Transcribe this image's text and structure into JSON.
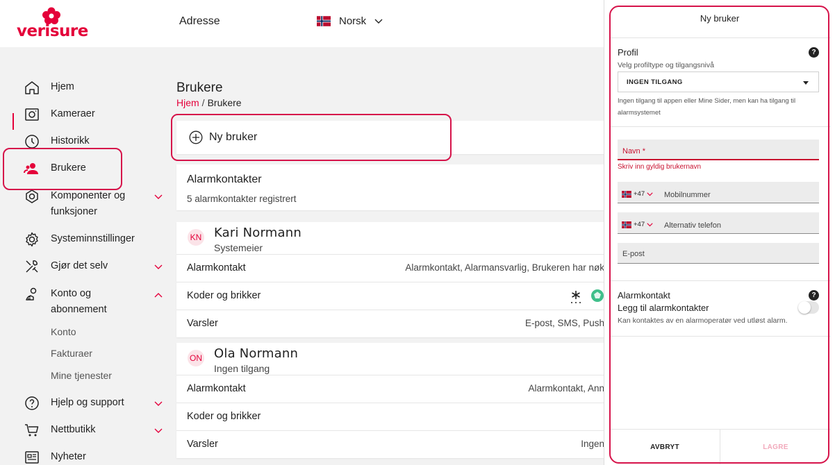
{
  "brand": {
    "name": "verisure",
    "color": "#e4003a"
  },
  "header": {
    "address_label": "Adresse",
    "language_label": "Norsk",
    "language_flag": "norway-flag-icon"
  },
  "sidebar": {
    "items": [
      {
        "label": "Hjem",
        "icon": "home-icon"
      },
      {
        "label": "Kameraer",
        "icon": "camera-icon"
      },
      {
        "label": "Historikk",
        "icon": "clock-icon"
      },
      {
        "label": "Brukere",
        "icon": "users-icon",
        "active": true
      },
      {
        "label_line1": "Komponenter og",
        "label_line2": "funksjoner",
        "icon": "components-icon"
      },
      {
        "label": "Systeminnstillinger",
        "icon": "gear-icon"
      },
      {
        "label": "Gjør det selv",
        "icon": "tools-icon"
      },
      {
        "label_line1": "Konto og",
        "label_line2": "abonnement",
        "icon": "account-icon"
      },
      {
        "label": "Hjelp og support",
        "icon": "help-icon"
      },
      {
        "label": "Nettbutikk",
        "icon": "cart-icon"
      },
      {
        "label": "Nyheter",
        "icon": "news-icon"
      }
    ],
    "sub_items": [
      "Konto",
      "Fakturaer",
      "Mine tjenester"
    ]
  },
  "main": {
    "title": "Brukere",
    "breadcrumb": {
      "home": "Hjem",
      "separator": "/",
      "current": "Brukere"
    },
    "new_user_label": "Ny bruker",
    "alarm_contacts": {
      "title": "Alarmkontakter",
      "subtitle": "5 alarmkontakter registrert"
    },
    "users": [
      {
        "initials": "KN",
        "name": "Kari Normann",
        "role": "Systemeier",
        "rows": [
          {
            "label": "Alarmkontakt",
            "value": "Alarmkontakt, Alarmansvarlig, Brukeren har nøk"
          },
          {
            "label": "Koder og brikker",
            "value": ""
          },
          {
            "label": "Varsler",
            "value": "E-post, SMS, Push"
          }
        ]
      },
      {
        "initials": "ON",
        "name": "Ola Normann",
        "role": "Ingen tilgang",
        "rows": [
          {
            "label": "Alarmkontakt",
            "value": "Alarmkontakt, Ann"
          },
          {
            "label": "Koder og brikker",
            "value": ""
          },
          {
            "label": "Varsler",
            "value": "Ingen"
          }
        ]
      }
    ]
  },
  "panel": {
    "title": "Ny bruker",
    "profile": {
      "title": "Profil",
      "subtitle": "Velg profiltype og tilgangsnivå",
      "selected": "INGEN TILGANG",
      "description_line1": "Ingen tilgang til appen eller Mine Sider, men kan ha tilgang til",
      "description_line2": "alarmsystemet"
    },
    "name_field": {
      "placeholder": "Navn *",
      "error": "Skriv inn gyldig brukernavn"
    },
    "mobile_field": {
      "country_code": "+47",
      "placeholder": "Mobilnummer"
    },
    "alt_phone_field": {
      "country_code": "+47",
      "placeholder": "Alternativ telefon"
    },
    "email_field": {
      "placeholder": "E-post"
    },
    "alarm_contact": {
      "title": "Alarmkontakt",
      "toggle_label": "Legg til alarmkontakter",
      "toggle_hint": "Kan kontaktes av en alarmoperatør ved utløst alarm.",
      "enabled": false
    },
    "help_glyph": "?",
    "cancel_label": "AVBRYT",
    "save_label": "LAGRE"
  }
}
